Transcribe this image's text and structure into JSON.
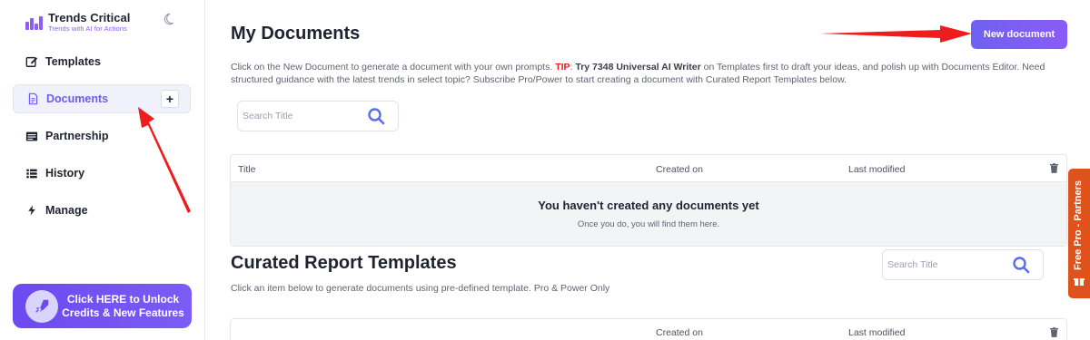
{
  "brand": {
    "title": "Trends Critical",
    "subtitle": "Trends with AI for Actions",
    "accent": "#8b5cf6"
  },
  "sidebar": {
    "items": [
      {
        "label": "Templates",
        "icon": "edit-icon"
      },
      {
        "label": "Documents",
        "icon": "document-icon",
        "active": true
      },
      {
        "label": "Partnership",
        "icon": "id-card-icon"
      },
      {
        "label": "History",
        "icon": "list-icon"
      },
      {
        "label": "Manage",
        "icon": "bolt-icon"
      }
    ],
    "add_label": "+",
    "promo_text": "Click HERE to Unlock Credits & New Features"
  },
  "main": {
    "title": "My Documents",
    "new_document_label": "New document",
    "intro_1": "Click on the New Document to generate a document with your own prompts. ",
    "intro_tip": "TIP",
    "intro_2": ": ",
    "intro_bold": "Try 7348 Universal AI Writer",
    "intro_3": " on Templates first to draft your ideas, and polish up with Documents Editor. Need structured guidance with the latest trends in select topic? Subscribe Pro/Power to start creating a document with Curated Report Templates below.",
    "search_placeholder": "Search Title",
    "table": {
      "col_title": "Title",
      "col_created": "Created on",
      "col_modified": "Last modified",
      "empty_heading": "You haven't created any documents yet",
      "empty_sub": "Once you do, you will find them here."
    }
  },
  "templates": {
    "title": "Curated Report Templates",
    "subtitle": "Click an item below to generate documents using pre-defined template. Pro & Power Only",
    "search_placeholder": "Search Title",
    "col_created": "Created on",
    "col_modified": "Last modified"
  },
  "side_tab": {
    "label": "Free Pro - Partners",
    "color": "#e0521c"
  }
}
